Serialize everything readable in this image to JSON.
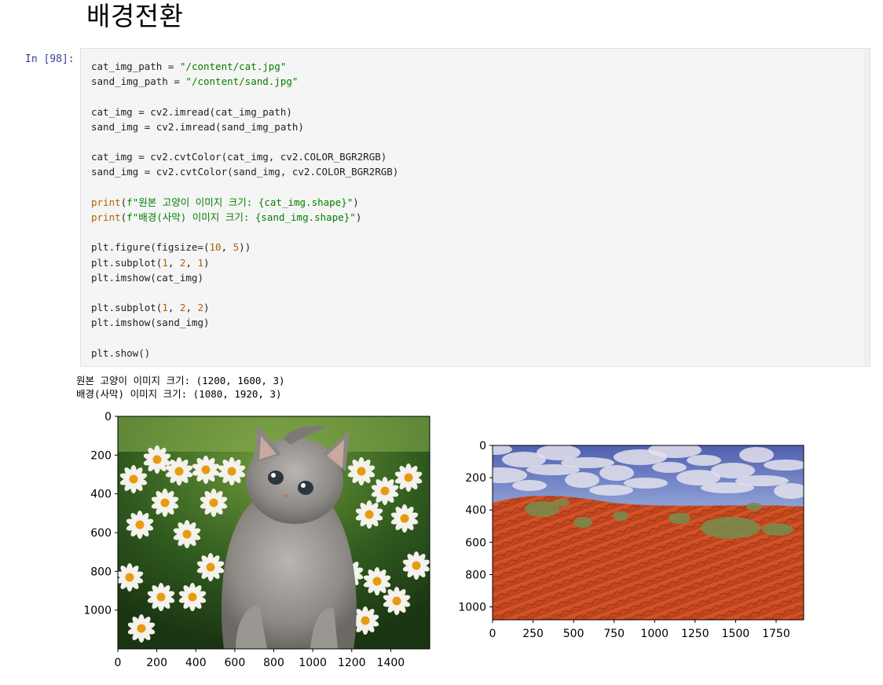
{
  "heading": "배경전환",
  "cell": {
    "prompt": "In [98]:",
    "code": [
      [
        [
          "",
          "cat_img_path = "
        ],
        [
          "s",
          "\"/content/cat.jpg\""
        ]
      ],
      [
        [
          "",
          "sand_img_path = "
        ],
        [
          "s",
          "\"/content/sand.jpg\""
        ]
      ],
      [],
      [
        [
          "",
          "cat_img = cv2.imread(cat_img_path)"
        ]
      ],
      [
        [
          "",
          "sand_img = cv2.imread(sand_img_path)"
        ]
      ],
      [],
      [
        [
          "",
          "cat_img = cv2.cvtColor(cat_img, cv2.COLOR_BGR2RGB)"
        ]
      ],
      [
        [
          "",
          "sand_img = cv2.cvtColor(sand_img, cv2.COLOR_BGR2RGB)"
        ]
      ],
      [],
      [
        [
          "b",
          "print"
        ],
        [
          "",
          "("
        ],
        [
          "s",
          "f\"원본 고양이 이미지 크기: {cat_img.shape}\""
        ],
        [
          "",
          ")"
        ]
      ],
      [
        [
          "b",
          "print"
        ],
        [
          "",
          "("
        ],
        [
          "s",
          "f\"배경(사막) 이미지 크기: {sand_img.shape}\""
        ],
        [
          "",
          ")"
        ]
      ],
      [],
      [
        [
          "",
          "plt.figure(figsize=("
        ],
        [
          "n",
          "10"
        ],
        [
          "",
          ", "
        ],
        [
          "n",
          "5"
        ],
        [
          "",
          "))"
        ]
      ],
      [
        [
          "",
          "plt.subplot("
        ],
        [
          "n",
          "1"
        ],
        [
          "",
          ", "
        ],
        [
          "n",
          "2"
        ],
        [
          "",
          ", "
        ],
        [
          "n",
          "1"
        ],
        [
          "",
          ")"
        ]
      ],
      [
        [
          "",
          "plt.imshow(cat_img)"
        ]
      ],
      [],
      [
        [
          "",
          "plt.subplot("
        ],
        [
          "n",
          "1"
        ],
        [
          "",
          ", "
        ],
        [
          "n",
          "2"
        ],
        [
          "",
          ", "
        ],
        [
          "n",
          "2"
        ],
        [
          "",
          ")"
        ]
      ],
      [
        [
          "",
          "plt.imshow(sand_img)"
        ]
      ],
      [],
      [
        [
          "",
          "plt.show()"
        ]
      ]
    ]
  },
  "output": {
    "line1": "원본 고양이 이미지 크기: (1200, 1600, 3)",
    "line2": "배경(사막) 이미지 크기: (1080, 1920, 3)"
  },
  "chart_data": [
    {
      "type": "image",
      "image_subject": "cat-image",
      "image_width": 1600,
      "image_height": 1200,
      "xticks": [
        0,
        200,
        400,
        600,
        800,
        1000,
        1200,
        1400
      ],
      "yticks": [
        0,
        200,
        400,
        600,
        800,
        1000
      ]
    },
    {
      "type": "image",
      "image_subject": "desert-image",
      "image_width": 1920,
      "image_height": 1080,
      "xticks": [
        0,
        250,
        500,
        750,
        1000,
        1250,
        1500,
        1750
      ],
      "yticks": [
        0,
        200,
        400,
        600,
        800,
        1000
      ]
    }
  ]
}
